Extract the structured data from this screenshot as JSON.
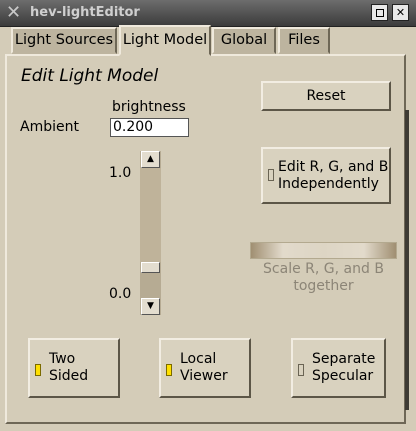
{
  "window": {
    "title": "hev-lightEditor"
  },
  "tabs": [
    {
      "label": "Light Sources"
    },
    {
      "label": "Light Model"
    },
    {
      "label": "Global"
    },
    {
      "label": "Files"
    }
  ],
  "panel": {
    "heading": "Edit Light Model",
    "brightness_label": "brightness",
    "ambient_label": "Ambient",
    "ambient_value": "0.200",
    "slider": {
      "max_label": "1.0",
      "min_label": "0.0",
      "value": 0.2
    },
    "reset_label": "Reset",
    "rgb_button": {
      "line1": "Edit R, G, and B",
      "line2": "Independently",
      "checked": false
    },
    "scale_label_line1": "Scale R, G, and B",
    "scale_label_line2": "together",
    "toggles": [
      {
        "line1": "Two",
        "line2": "Sided",
        "checked": true
      },
      {
        "line1": "Local",
        "line2": "Viewer",
        "checked": true
      },
      {
        "line1": "Separate",
        "line2": "Specular",
        "checked": false
      }
    ]
  },
  "colors": {
    "indicator_on": "#ffe000",
    "background": "#d4ccb8"
  }
}
